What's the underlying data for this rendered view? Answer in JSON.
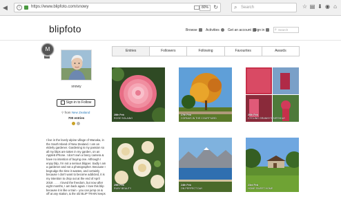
{
  "browser": {
    "url": "https://www.blipfoto.com/snowy",
    "zoom": "80%",
    "search_placeholder": "Search"
  },
  "site": {
    "logo": "blipfoto",
    "nav": {
      "browse": "Browse",
      "activities": "Activities",
      "get_account": "Get an account",
      "sign_in": "Sign in"
    },
    "search_placeholder": "Search"
  },
  "badge_letter": "M",
  "tabs": [
    "Entries",
    "Followers",
    "Following",
    "Favourites",
    "Awards"
  ],
  "profile": {
    "username": "snowy",
    "follow_label": "Sign in to Follow",
    "from_prefix": "from",
    "from_place": "New Zealand",
    "entries": "700 entries",
    "bio": "I live in the lovely alpine village of Wanaka, in the South Island of New Zealand. I am an elderly gardener. Gardening is my passion so all my blips are taken in my garden, on an Apple6 iPhone. I don't own a fancy camera & have no intention of buying one. Although I enjoy blip, I'm not a serious blipper. Sadly I am a gardener and not a photographer. Because I begrudge the time it wastes, and certainly because I don't want to become addicted, it is my intention to drop out at the end of April 2018 . . . . I loved the freedom, but now after eight months, I am back again. I love this blip because it is like a train - you can jump on & off at any station, & the old BLIP TRAIN keeps"
  },
  "entries": [
    {
      "date": "28th Feb",
      "title": "ROSE SOLAINO"
    },
    {
      "date": "27th Feb",
      "title": "CORNUS IN THE COURTYARD"
    },
    {
      "date": "26th Feb",
      "title": "CYCLING GRANNY'S BIRTHDAY"
    },
    {
      "date": "25th Feb",
      "title": "RUBY BEAUTY"
    },
    {
      "date": "24th Feb",
      "title": "ON PERFECT DAY"
    },
    {
      "date": "23rd Feb",
      "title": "HOME SWEET HOME"
    }
  ],
  "colors": {
    "link": "#2a7ab8",
    "coin1": "#c9a227",
    "coin2": "#b9b9b9"
  }
}
